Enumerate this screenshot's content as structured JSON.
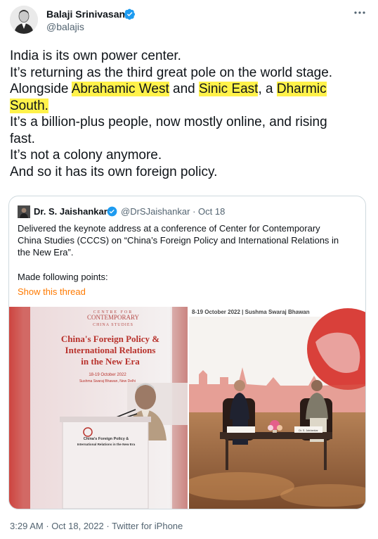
{
  "author": {
    "name": "Balaji Srinivasan",
    "handle": "@balajis"
  },
  "tweet": {
    "lines": [
      "India is its own power center.",
      "It’s returning as the third great pole on the world stage.",
      {
        "pre": "Alongside ",
        "h1": "Abrahamic West",
        "mid1": " and ",
        "h2": "Sinic East",
        "mid2": ", a ",
        "h3": "Dharmic"
      },
      {
        "h4": "South."
      },
      "It’s a billion-plus people, now mostly online, and rising",
      "fast.",
      "It’s not a colony anymore.",
      "And so it has its own foreign policy."
    ],
    "highlight_color": "#fff24a"
  },
  "quote": {
    "name": "Dr. S. Jaishankar",
    "handle": "@DrSJaishankar",
    "separator": "·",
    "date": "Oct 18",
    "text_lines": [
      "Delivered the keynote address at a conference of Center for Contemporary",
      "China Studies (CCCS) on “China’s Foreign Policy and International Relations in",
      "the New Era”."
    ],
    "made_points": "Made following points:",
    "show_thread": "Show this thread",
    "image1": {
      "logo_top": "CENTRE FOR",
      "logo_mid": "CONTEMPORARY",
      "logo_bot": "CHINA STUDIES",
      "title_1": "China's Foreign Policy &",
      "title_2": "International Relations",
      "title_3": "in the New Era",
      "dates": "18-19 October 2022",
      "venue": "Sushma Swaraj Bhawan, New Delhi",
      "podium_1": "China's Foreign Policy &",
      "podium_2": "International Relations in the New Era"
    },
    "image2": {
      "banner": "8-19 October 2022 | Sushma Swaraj Bhawan",
      "nameplate_1": "",
      "nameplate_2": "Dr. S. Jaishankar"
    }
  },
  "footer": {
    "time": "3:29 AM",
    "sep": "·",
    "date": "Oct 18, 2022",
    "sep2": "·",
    "source": "Twitter for iPhone"
  },
  "colors": {
    "verified": "#1d9bf0",
    "muted": "#536471",
    "thread": "#ff7a00"
  }
}
